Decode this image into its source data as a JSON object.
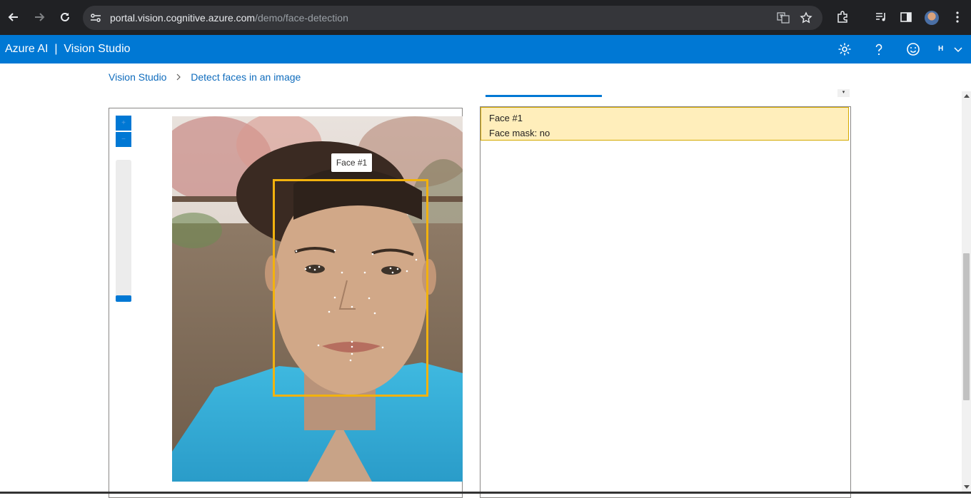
{
  "browser": {
    "url_host": "portal.vision.cognitive.azure.com",
    "url_path": "/demo/face-detection"
  },
  "header": {
    "title": "Azure AI  |  Vision Studio",
    "user_initial": "H",
    "bar_color": "#0078d4"
  },
  "breadcrumb": {
    "root": "Vision Studio",
    "current": "Detect faces in an image"
  },
  "image_viewer": {
    "face_label": "Face #1",
    "box_color": "#f2b20e"
  },
  "results": [
    {
      "title": "Face #1",
      "detail": "Face mask: no"
    }
  ]
}
